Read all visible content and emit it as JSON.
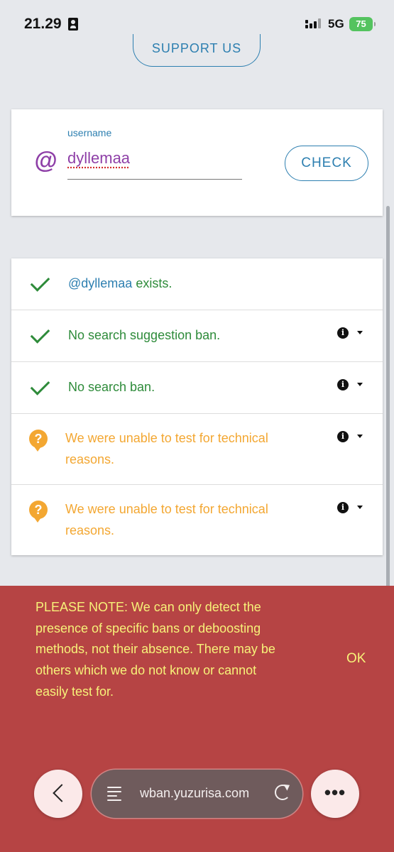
{
  "status_bar": {
    "time": "21.29",
    "network": "5G",
    "battery": "75"
  },
  "header": {
    "support_label": "SUPPORT US"
  },
  "lookup": {
    "field_label": "username",
    "at_symbol": "@",
    "value": "dyllemaa",
    "check_label": "CHECK"
  },
  "results": {
    "exists": {
      "handle": "@dyllemaa",
      "text": " exists."
    },
    "suggestion_ban": "No search suggestion ban.",
    "search_ban": "No search ban.",
    "unable_1": "We were unable to test for technical reasons.",
    "unable_2": "We were unable to test for technical reasons."
  },
  "note": {
    "text": "PLEASE NOTE: We can only detect the presence of specific bans or deboosting methods, not their absence. There may be others which we do not know or cannot easily test for.",
    "ok_label": "OK"
  },
  "browser": {
    "url": "wban.yuzurisa.com"
  },
  "colors": {
    "accent": "#2d7fb0",
    "success": "#2e8b3a",
    "warning": "#f3a732",
    "note_bg": "#b64444",
    "note_text": "#f7f279",
    "username": "#8e3fa7"
  }
}
